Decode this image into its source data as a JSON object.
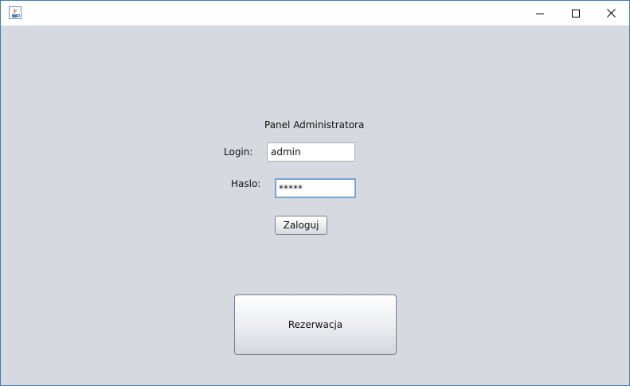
{
  "window": {
    "title": "",
    "controls": {
      "minimize": "minimize-icon",
      "maximize": "maximize-icon",
      "close": "close-icon"
    }
  },
  "panel": {
    "title": "Panel Administratora",
    "login_label": "Login:",
    "login_value": "admin",
    "haslo_label": "Haslo:",
    "haslo_value": "*****",
    "zaloguj_label": "Zaloguj"
  },
  "rezerwacja_label": "Rezerwacja",
  "colors": {
    "background": "#d6d9df",
    "focus_border": "#7aa3cf",
    "window_border": "#3c7fb1"
  }
}
